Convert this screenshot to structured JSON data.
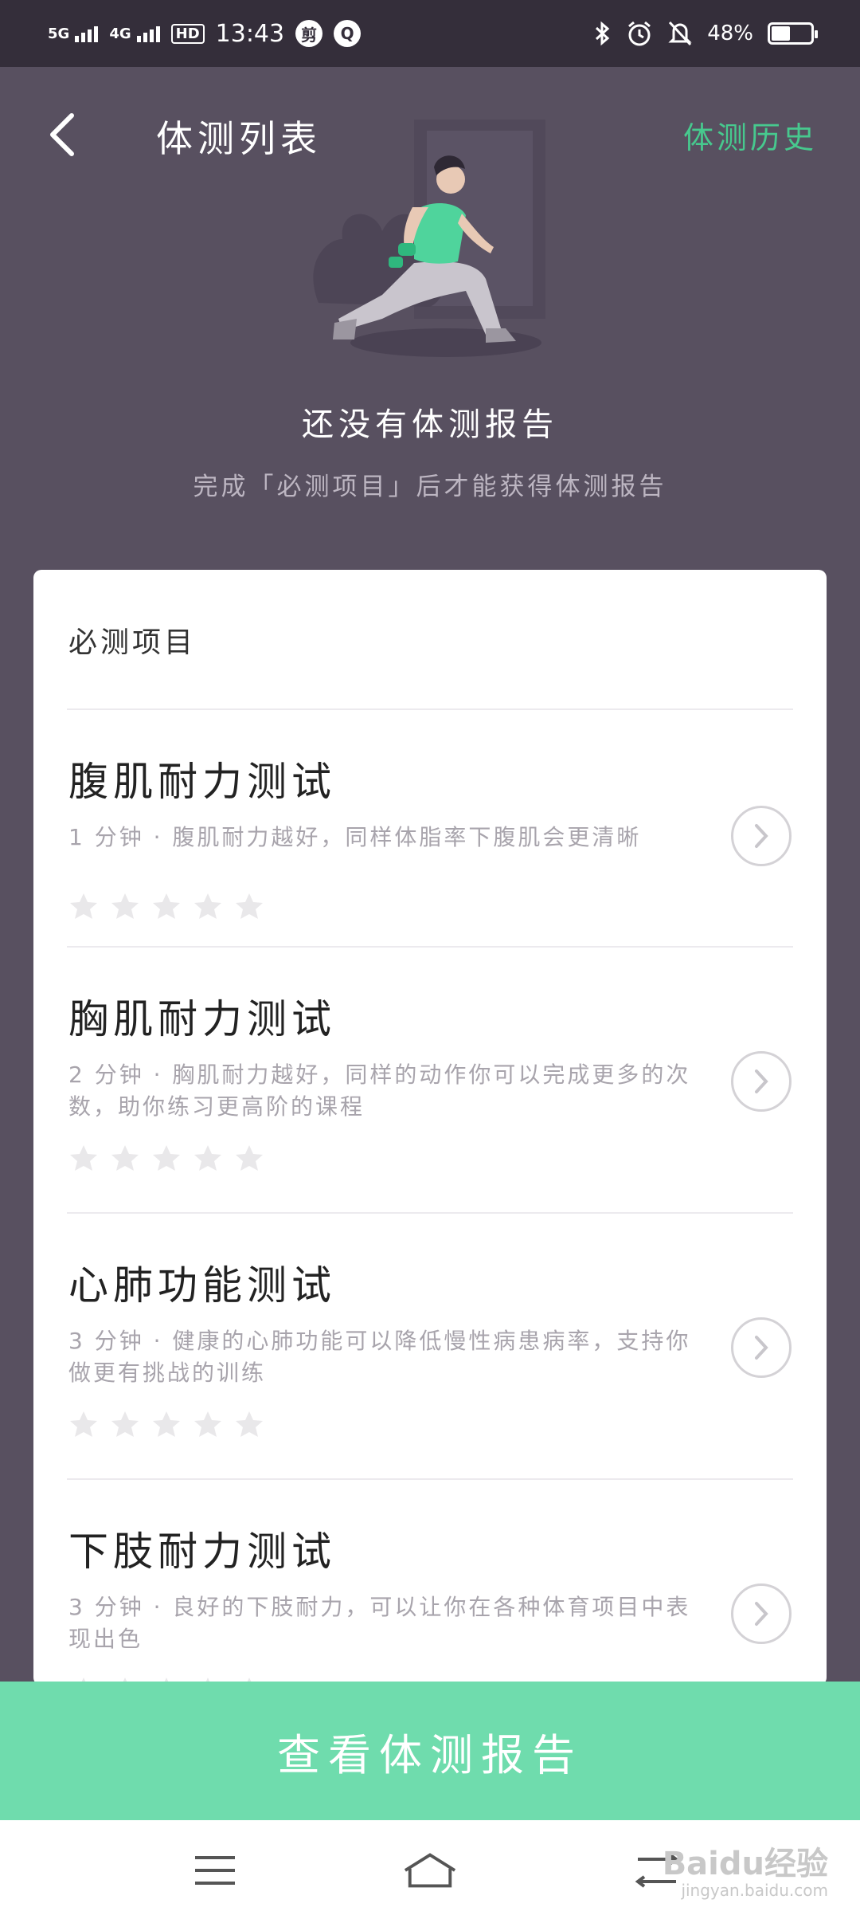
{
  "status_bar": {
    "network_1": "5G",
    "network_2": "4G",
    "hd": "HD",
    "time": "13:43",
    "app_icon_1": "剪",
    "app_icon_2": "Q",
    "battery_text": "48%",
    "battery_level": 0.48
  },
  "header": {
    "title": "体测列表",
    "history_link": "体测历史"
  },
  "empty_state": {
    "title": "还没有体测报告",
    "subtitle": "完成「必测项目」后才能获得体测报告"
  },
  "section": {
    "heading": "必测项目"
  },
  "tests": [
    {
      "title": "腹肌耐力测试",
      "desc": "1 分钟 · 腹肌耐力越好，同样体脂率下腹肌会更清晰",
      "stars": 0
    },
    {
      "title": "胸肌耐力测试",
      "desc": "2 分钟 · 胸肌耐力越好，同样的动作你可以完成更多的次数，助你练习更高阶的课程",
      "stars": 0
    },
    {
      "title": "心肺功能测试",
      "desc": "3 分钟 · 健康的心肺功能可以降低慢性病患病率，支持你做更有挑战的训练",
      "stars": 0
    },
    {
      "title": "下肢耐力测试",
      "desc": "3 分钟 · 良好的下肢耐力，可以让你在各种体育项目中表现出色",
      "stars": 0
    }
  ],
  "cta": {
    "label": "查看体测报告"
  },
  "watermark": {
    "main": "Baidu经验",
    "sub": "jingyan.baidu.com"
  },
  "colors": {
    "accent": "#47c98e",
    "cta": "#6fdcad",
    "background": "#585060",
    "status_bar": "#342e3a"
  }
}
